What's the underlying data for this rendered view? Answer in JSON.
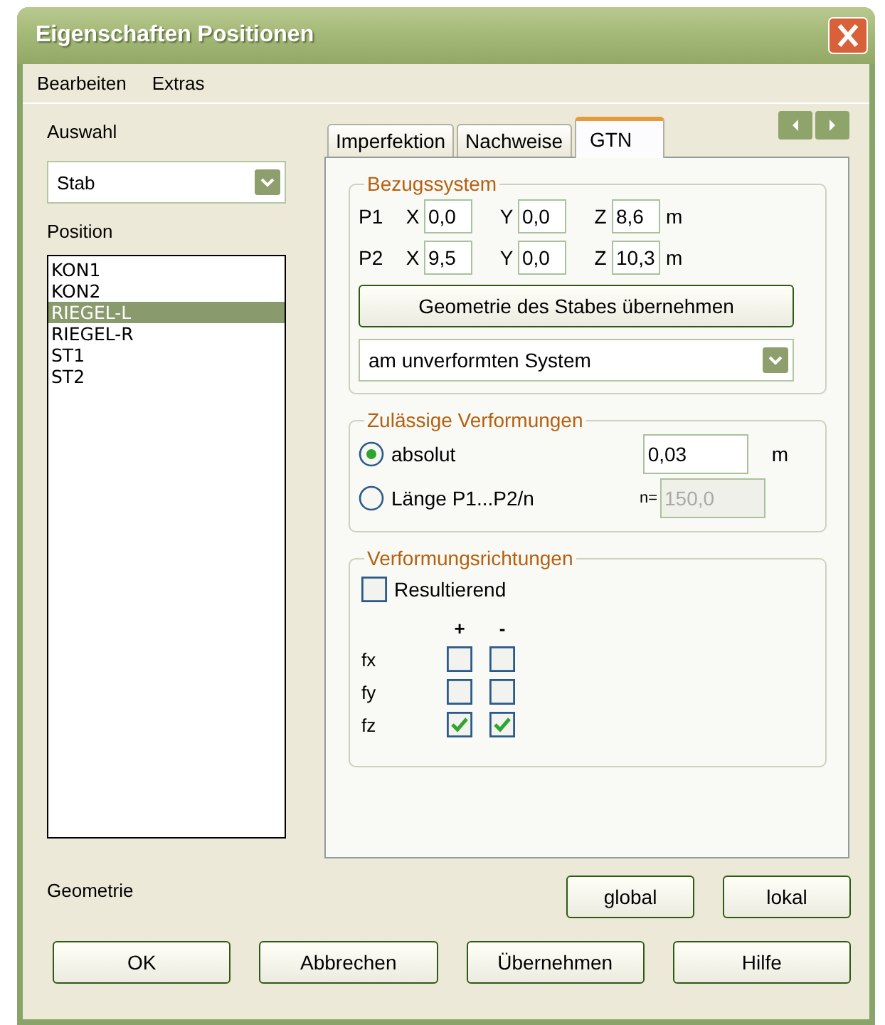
{
  "window": {
    "title": "Eigenschaften Positionen"
  },
  "menu": [
    {
      "label": "Bearbeiten"
    },
    {
      "label": "Extras"
    }
  ],
  "selection": {
    "label": "Auswahl",
    "value": "Stab"
  },
  "positions": {
    "label": "Position",
    "items": [
      {
        "label": "KON1",
        "selected": false
      },
      {
        "label": "KON2",
        "selected": false
      },
      {
        "label": "RIEGEL-L",
        "selected": true
      },
      {
        "label": "RIEGEL-R",
        "selected": false
      },
      {
        "label": "ST1",
        "selected": false
      },
      {
        "label": "ST2",
        "selected": false
      }
    ]
  },
  "tabs": [
    {
      "label": "Imperfektion",
      "selected": false
    },
    {
      "label": "Nachweise",
      "selected": false
    },
    {
      "label": "GTN",
      "selected": true
    }
  ],
  "reference_system": {
    "title": "Bezugssystem",
    "points": [
      {
        "label": "P1",
        "unit": "m",
        "coords": [
          {
            "axis": "X",
            "value": "0,0"
          },
          {
            "axis": "Y",
            "value": "0,0"
          },
          {
            "axis": "Z",
            "value": "8,6"
          }
        ]
      },
      {
        "label": "P2",
        "unit": "m",
        "coords": [
          {
            "axis": "X",
            "value": "9,5"
          },
          {
            "axis": "Y",
            "value": "0,0"
          },
          {
            "axis": "Z",
            "value": "10,3"
          }
        ]
      }
    ],
    "button": "Geometrie des Stabes übernehmen",
    "mode": "am unverformten System"
  },
  "allowed_deformations": {
    "title": "Zulässige Verformungen",
    "options": [
      {
        "label": "absolut",
        "selected": true,
        "value": "0,03",
        "unit": "m",
        "disabled": false
      },
      {
        "label": "Länge P1...P2/n",
        "selected": false,
        "prefix": "n=",
        "value": "150,0",
        "disabled": true
      }
    ]
  },
  "deformation_directions": {
    "title": "Verformungsrichtungen",
    "resultant": {
      "label": "Resultierend",
      "checked": false
    },
    "columns": [
      "+",
      "-"
    ],
    "rows": [
      {
        "label": "fx",
        "checks": [
          false,
          false
        ]
      },
      {
        "label": "fy",
        "checks": [
          false,
          false
        ]
      },
      {
        "label": "fz",
        "checks": [
          true,
          true
        ]
      }
    ]
  },
  "geometry": {
    "label": "Geometrie",
    "buttons": [
      "global",
      "lokal"
    ]
  },
  "buttons": [
    {
      "label": "OK"
    },
    {
      "label": "Abbrechen"
    },
    {
      "label": "Übernehmen"
    },
    {
      "label": "Hilfe"
    }
  ]
}
